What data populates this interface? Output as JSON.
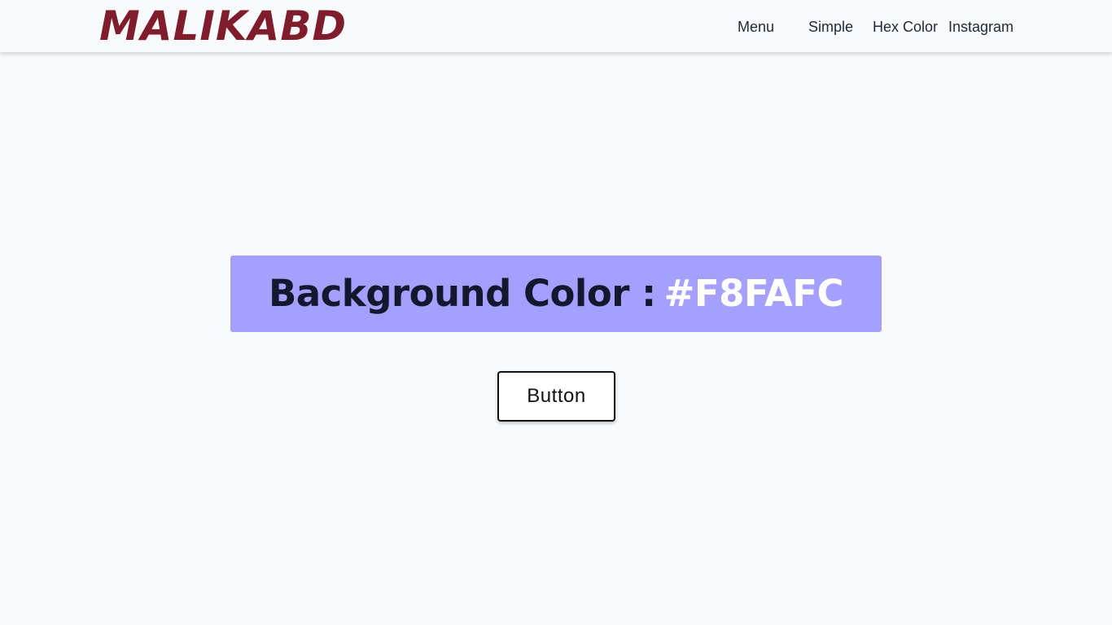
{
  "header": {
    "logo": "MALIKABD",
    "nav": {
      "menu": "Menu",
      "simple": "Simple",
      "hex_color": "Hex Color",
      "instagram": "Instagram"
    }
  },
  "main": {
    "banner_label": "Background Color :",
    "banner_value": "#F8FAFC",
    "button_label": "Button"
  },
  "colors": {
    "page_background": "#F8FAFC",
    "logo": "#7F1D2D",
    "banner_background": "#A5A0FD",
    "banner_label": "#14172E",
    "banner_value": "#FFFFFF"
  }
}
